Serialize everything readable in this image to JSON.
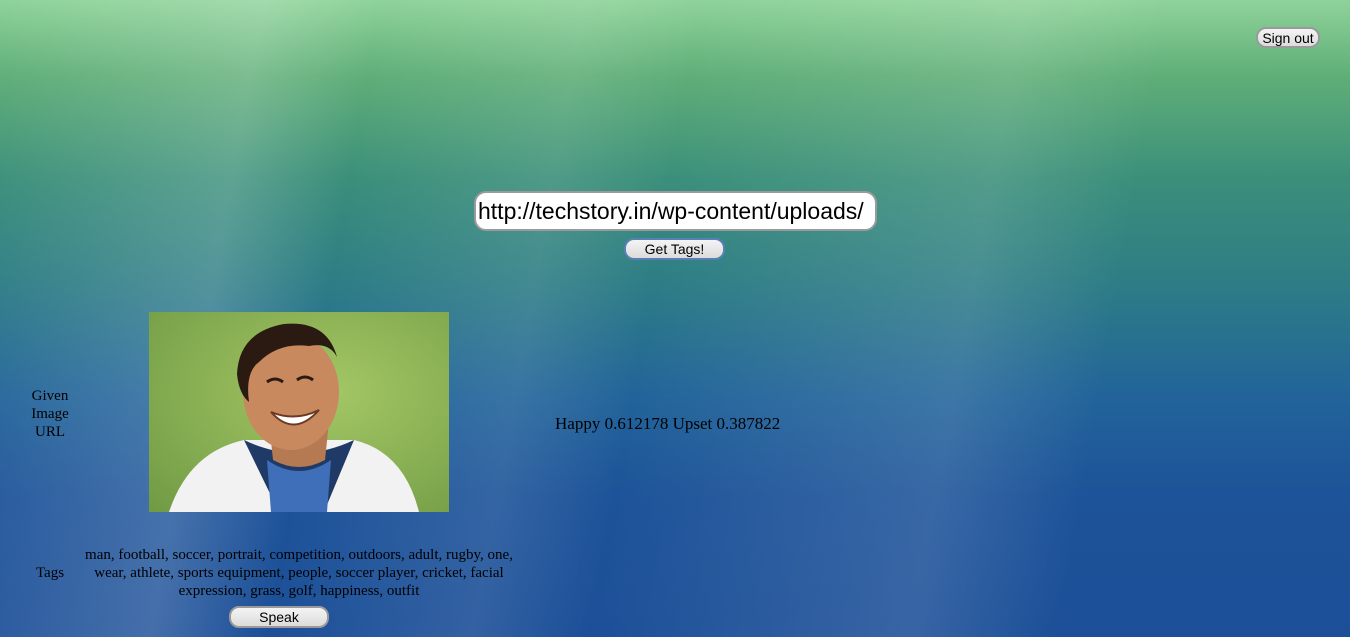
{
  "header": {
    "signout_label": "Sign out"
  },
  "search": {
    "url_value": "http://techstory.in/wp-content/uploads/",
    "button_label": "Get Tags!"
  },
  "result": {
    "given_label": "Given Image URL",
    "emotion_text": "Happy 0.612178 Upset 0.387822",
    "tags_label": "Tags",
    "tags_text": "man, football, soccer, portrait, competition, outdoors, adult, rugby, one, wear, athlete, sports equipment, people, soccer player, cricket, facial expression, grass, golf, happiness, outfit",
    "speak_label": "Speak"
  }
}
